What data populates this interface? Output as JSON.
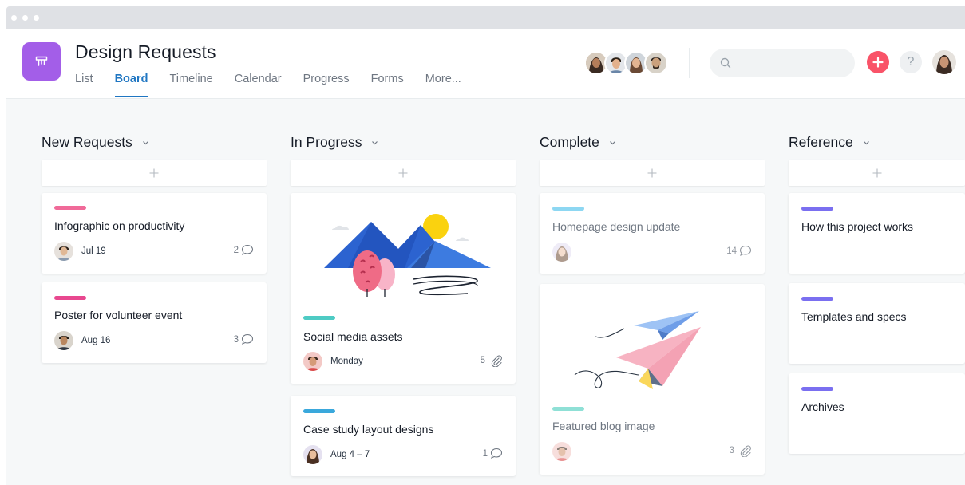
{
  "project": {
    "title": "Design Requests"
  },
  "tabs": [
    {
      "label": "List"
    },
    {
      "label": "Board"
    },
    {
      "label": "Timeline"
    },
    {
      "label": "Calendar"
    },
    {
      "label": "Progress"
    },
    {
      "label": "Forms"
    },
    {
      "label": "More..."
    }
  ],
  "active_tab": "Board",
  "colors": {
    "project_icon": "#a35ee8",
    "accent": "#1f76c2",
    "add_button": "#f95368",
    "tag_pink": "#f06a99",
    "tag_magenta": "#e8488f",
    "tag_teal": "#4ecbc4",
    "tag_blue": "#3aa8dc",
    "tag_light_blue": "#8dd7f2",
    "tag_light_teal": "#8fe0d6",
    "tag_purple": "#7a6ff0"
  },
  "columns": [
    {
      "name": "New Requests",
      "cards": [
        {
          "title": "Infographic on productivity",
          "date": "Jul 19",
          "count": "2",
          "count_icon": "comment-icon",
          "tag": "#f06a99"
        },
        {
          "title": "Poster for volunteer event",
          "date": "Aug 16",
          "count": "3",
          "count_icon": "comment-icon",
          "tag": "#e8488f"
        }
      ]
    },
    {
      "name": "In Progress",
      "cards": [
        {
          "title": "Social media assets",
          "date": "Monday",
          "count": "5",
          "count_icon": "paperclip-icon",
          "tag": "#4ecbc4"
        },
        {
          "title": "Case study layout designs",
          "date": "Aug 4 – 7",
          "count": "1",
          "count_icon": "comment-icon",
          "tag": "#3aa8dc"
        }
      ]
    },
    {
      "name": "Complete",
      "cards": [
        {
          "title": "Homepage design update",
          "count": "14",
          "count_icon": "comment-icon",
          "tag": "#8dd7f2"
        },
        {
          "title": "Featured blog image",
          "count": "3",
          "count_icon": "paperclip-icon",
          "tag": "#8fe0d6"
        }
      ]
    },
    {
      "name": "Reference",
      "cards": [
        {
          "title": "How this project works",
          "tag": "#7a6ff0"
        },
        {
          "title": "Templates and specs",
          "tag": "#7a6ff0"
        },
        {
          "title": "Archives",
          "tag": "#7a6ff0"
        }
      ]
    }
  ]
}
